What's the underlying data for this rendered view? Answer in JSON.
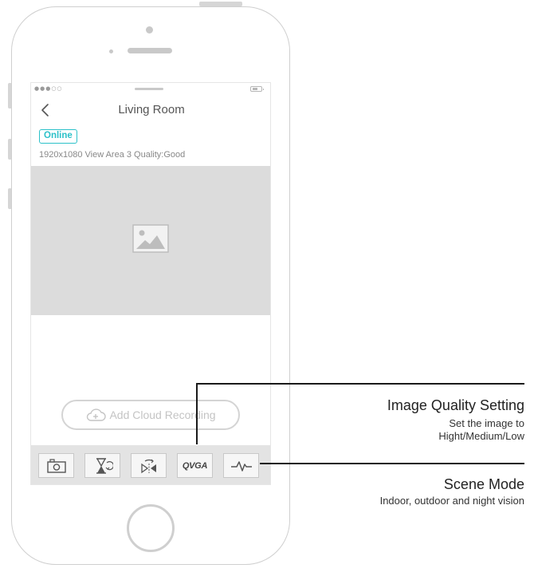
{
  "screen": {
    "title": "Living Room",
    "status_badge": "Online",
    "info_line": "1920x1080 View Area 3 Quality:Good",
    "status_dots": "●●●○○",
    "cloud_button_label": "Add Cloud Recording"
  },
  "toolbar": {
    "buttons": [
      {
        "icon": "camera-snapshot-icon"
      },
      {
        "icon": "hourglass-icon"
      },
      {
        "icon": "flip-mirror-icon"
      },
      {
        "icon": "qvga-icon",
        "label": "QVGA"
      },
      {
        "icon": "pulse-wave-icon"
      }
    ]
  },
  "callouts": {
    "image_quality": {
      "title": "Image Quality Setting",
      "desc_line1": "Set the image to",
      "desc_line2": "Hight/Medium/Low"
    },
    "scene_mode": {
      "title": "Scene Mode",
      "desc": "Indoor, outdoor and night vision"
    }
  },
  "colors": {
    "accent": "#2cc1c9",
    "video_placeholder": "#dcdcdc",
    "toolbar_bg": "#e3e3e3",
    "phone_outline": "#cfcfcf"
  }
}
